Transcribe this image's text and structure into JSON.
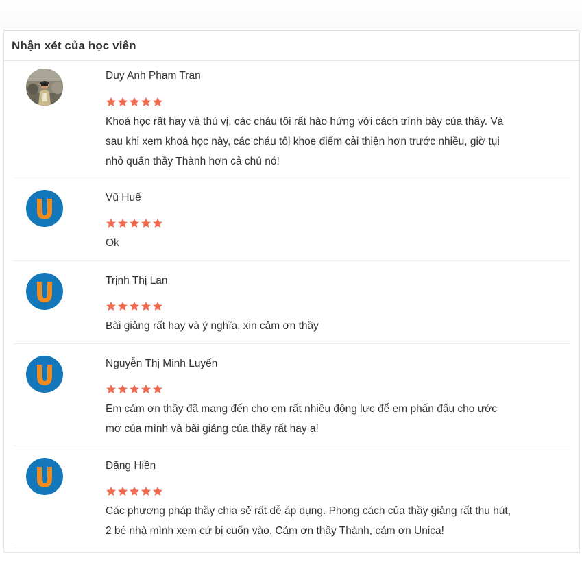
{
  "section": {
    "title": "Nhận xét của học viên"
  },
  "colors": {
    "star": "#ef6a4f",
    "avatar_bg": "#1377b9",
    "avatar_letter": "#f08a1c"
  },
  "reviews": [
    {
      "name": "Duy Anh Pham Tran",
      "avatar": "photo",
      "rating": 5,
      "text_lines": [
        "Khoá học rất hay và thú vị, các cháu tôi rất hào hứng với cách trình bày của thầy. Và",
        "sau khi xem khoá học này, các cháu tôi khoe điểm cải thiện hơn trước nhiều, giờ tụi",
        "nhỏ quấn thầy Thành hơn cả chú nó!"
      ]
    },
    {
      "name": "Vũ Huế",
      "avatar": "U",
      "rating": 5,
      "text_lines": [
        "Ok"
      ]
    },
    {
      "name": "Trịnh Thị Lan",
      "avatar": "U",
      "rating": 5,
      "text_lines": [
        "Bài giảng rất hay và ý nghĩa, xin cảm ơn thầy"
      ]
    },
    {
      "name": "Nguyễn Thị Minh Luyến",
      "avatar": "U",
      "rating": 5,
      "text_lines": [
        "Em cảm ơn thầy đã mang đến cho em rất nhiều động lực để em phấn đấu cho ước",
        "mơ của mình và bài giảng của thầy rất hay ạ!"
      ]
    },
    {
      "name": "Đặng Hiền",
      "avatar": "U",
      "rating": 5,
      "text_lines": [
        "Các phương pháp thầy chia sẻ rất dễ áp dụng. Phong cách của thầy giảng rất thu hút,",
        "2 bé nhà mình xem cứ bị cuốn vào. Cảm ơn thầy Thành, cảm ơn Unica!"
      ]
    }
  ]
}
